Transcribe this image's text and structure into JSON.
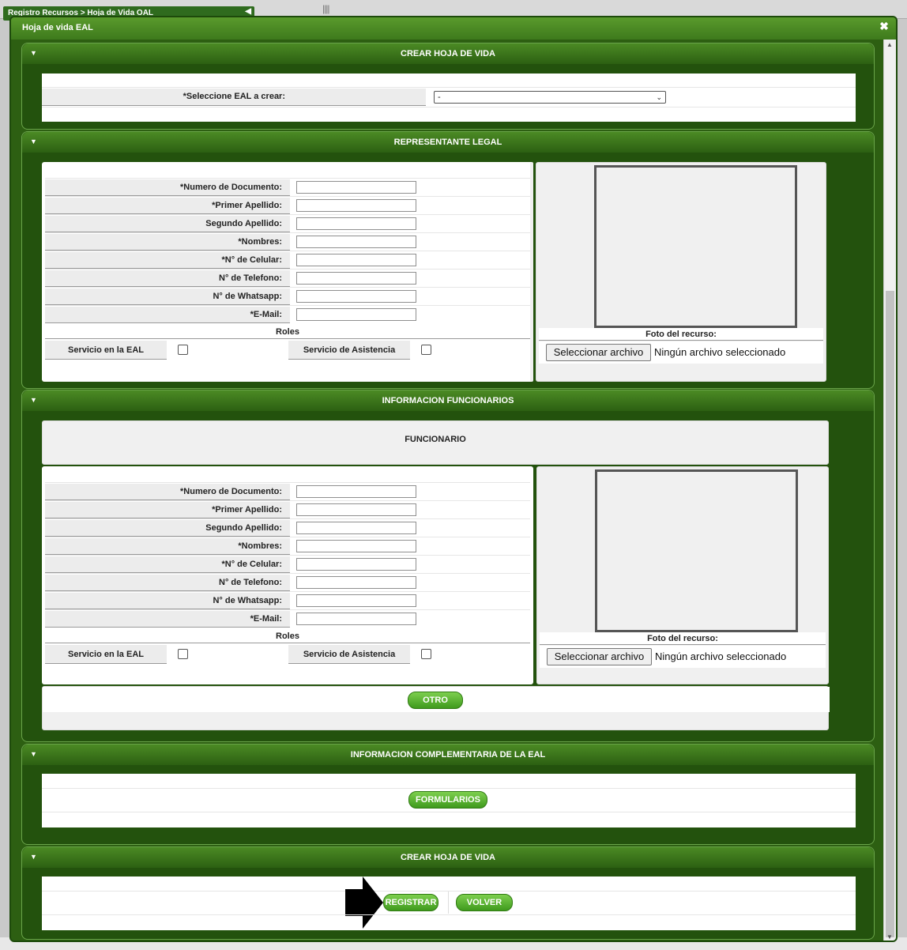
{
  "background": {
    "breadcrumb": "Registro Recursos > Hoja de Vida OAL"
  },
  "modal": {
    "title": "Hoja de vida EAL"
  },
  "section_crear": {
    "title": "CREAR HOJA DE VIDA",
    "select_label": "*Seleccione EAL a crear:",
    "select_value": "-"
  },
  "section_representante": {
    "title": "REPRESENTANTE LEGAL",
    "fields": [
      "*Numero de Documento:",
      "*Primer Apellido:",
      "Segundo Apellido:",
      "*Nombres:",
      "*N° de Celular:",
      "N° de Telefono:",
      "N° de Whatsapp:",
      "*E-Mail:"
    ],
    "roles_label": "Roles",
    "role1": "Servicio en la EAL",
    "role2": "Servicio de Asistencia",
    "photo_label": "Foto del recurso:",
    "file_button": "Seleccionar archivo",
    "file_status": "Ningún archivo seleccionado"
  },
  "section_funcionarios": {
    "title": "INFORMACION FUNCIONARIOS",
    "subtitle": "FUNCIONARIO",
    "fields": [
      "*Numero de Documento:",
      "*Primer Apellido:",
      "Segundo Apellido:",
      "*Nombres:",
      "*N° de Celular:",
      "N° de Telefono:",
      "N° de Whatsapp:",
      "*E-Mail:"
    ],
    "roles_label": "Roles",
    "role1": "Servicio en la EAL",
    "role2": "Servicio de Asistencia",
    "photo_label": "Foto del recurso:",
    "file_button": "Seleccionar archivo",
    "file_status": "Ningún archivo seleccionado",
    "otro_button": "OTRO"
  },
  "section_complementaria": {
    "title": "INFORMACION COMPLEMENTARIA DE LA EAL",
    "formularios_button": "FORMULARIOS"
  },
  "section_final": {
    "title": "CREAR HOJA DE VIDA",
    "registrar_button": "REGISTRAR",
    "volver_button": "VOLVER"
  },
  "icons": {
    "close": "close-icon",
    "toggle": "triangle-down-icon",
    "pointer": "arrow-right-icon"
  }
}
